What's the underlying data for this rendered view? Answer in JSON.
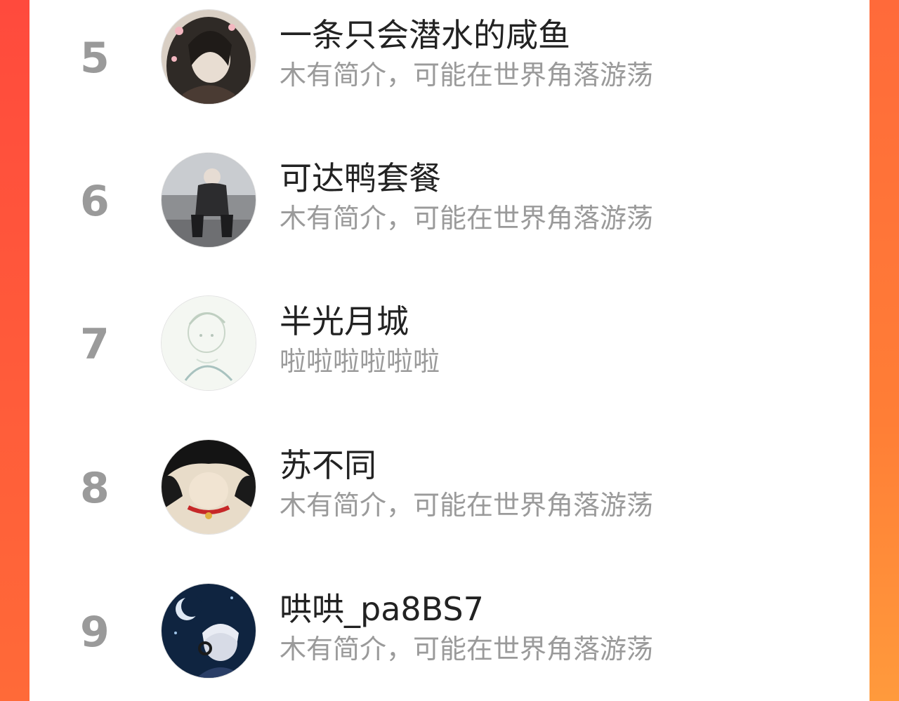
{
  "ranking": {
    "items": [
      {
        "rank": "5",
        "name": "一条只会潜水的咸鱼",
        "bio": "木有简介，可能在世界角落游荡",
        "avatar_icon": "avatar-girl-hood-icon"
      },
      {
        "rank": "6",
        "name": "可达鸭套餐",
        "bio": "木有简介，可能在世界角落游荡",
        "avatar_icon": "avatar-crouching-boy-icon"
      },
      {
        "rank": "7",
        "name": "半光月城",
        "bio": "啦啦啦啦啦啦",
        "avatar_icon": "avatar-sketch-girl-icon"
      },
      {
        "rank": "8",
        "name": "苏不同",
        "bio": "木有简介，可能在世界角落游荡",
        "avatar_icon": "avatar-dark-hair-icon"
      },
      {
        "rank": "9",
        "name": "哄哄_pa8BS7",
        "bio": "木有简介，可能在世界角落游荡",
        "avatar_icon": "avatar-moon-night-icon"
      }
    ]
  },
  "colors": {
    "accent_left": "#ff4a3d",
    "accent_right": "#ff7e36",
    "rank_gray": "#9a9a9a",
    "name_dark": "#222222"
  }
}
